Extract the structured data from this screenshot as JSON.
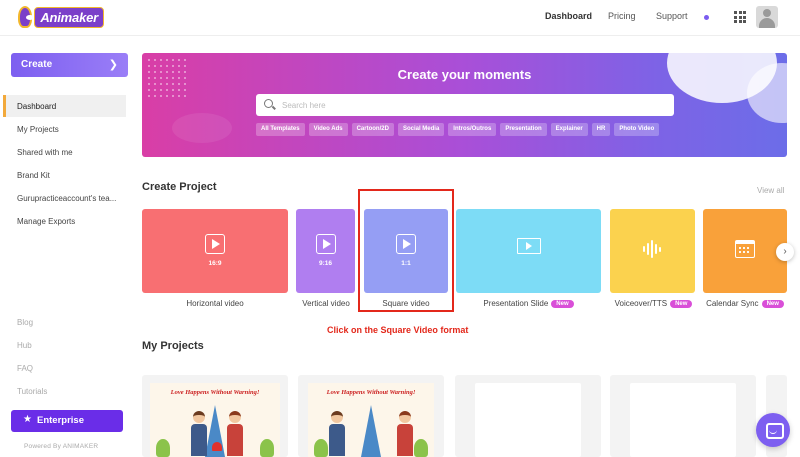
{
  "brand": {
    "name": "Animaker",
    "accent": "#7d5ff0"
  },
  "header": {
    "nav": [
      "Dashboard",
      "Pricing",
      "Support"
    ]
  },
  "sidebar": {
    "create_label": "Create",
    "items": [
      "Dashboard",
      "My Projects",
      "Shared with me",
      "Brand Kit",
      "Gurupracticeaccount's tea...",
      "Manage Exports"
    ],
    "active_item": "Dashboard",
    "links": [
      "Blog",
      "Hub",
      "FAQ",
      "Tutorials"
    ],
    "enterprise_label": "Enterprise",
    "powered_by": "Powered By ANIMAKER"
  },
  "banner": {
    "title": "Create your moments",
    "search_placeholder": "Search here",
    "chips": [
      "All Templates",
      "Video Ads",
      "Cartoon/2D",
      "Social Media",
      "Intros/Outros",
      "Presentation",
      "Explainer",
      "HR",
      "Photo Video"
    ]
  },
  "create_project": {
    "title": "Create Project",
    "view_all": "View all",
    "new_badge": "New",
    "cards": [
      {
        "label": "Horizontal video",
        "ratio": "16:9",
        "color": "#f86f72",
        "icon": "play-icon",
        "is_new": false
      },
      {
        "label": "Vertical video",
        "ratio": "9:16",
        "color": "#b07ef0",
        "icon": "play-icon",
        "is_new": false
      },
      {
        "label": "Square video",
        "ratio": "1:1",
        "color": "#959ef4",
        "icon": "play-icon",
        "is_new": false
      },
      {
        "label": "Presentation Slide",
        "ratio": "",
        "color": "#7ddcf6",
        "icon": "presentation-icon",
        "is_new": true
      },
      {
        "label": "Voiceover/TTS",
        "ratio": "",
        "color": "#fbd24e",
        "icon": "waveform-icon",
        "is_new": true
      },
      {
        "label": "Calendar Sync",
        "ratio": "",
        "color": "#f9a13a",
        "icon": "calendar-icon",
        "is_new": true
      }
    ]
  },
  "annotation": {
    "text": "Click on the Square Video format",
    "color": "#e3281b"
  },
  "my_projects": {
    "title": "My Projects",
    "thumb_title": "Love Happens Without Warning!"
  }
}
